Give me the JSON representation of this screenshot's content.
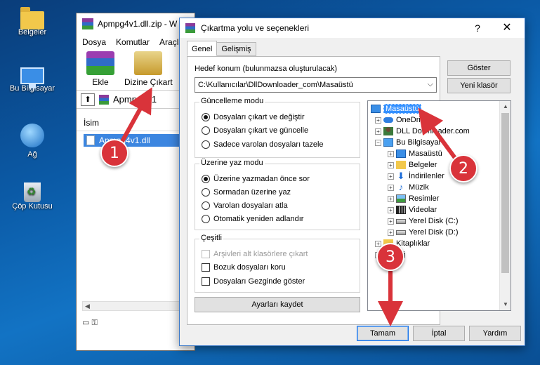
{
  "desktop": {
    "icons": [
      {
        "label": "Belgeler",
        "icon": "user-folder-icon"
      },
      {
        "label": "Bu Bilgisayar",
        "icon": "computer-icon"
      },
      {
        "label": "Ağ",
        "icon": "network-icon"
      },
      {
        "label": "Çöp Kutusu",
        "icon": "recycle-bin-icon"
      }
    ]
  },
  "bg_window": {
    "title": "Apmpg4v1.dll.zip - W",
    "menu": [
      "Dosya",
      "Komutlar",
      "Araçla"
    ],
    "tools": {
      "add": "Ekle",
      "extract": "Dizine Çıkart"
    },
    "path": "Apmpg4v1",
    "column_name": "İsim",
    "file_row": "Apmpg4v1.dll"
  },
  "dialog": {
    "title": "Çıkartma yolu ve seçenekleri",
    "help_symbol": "?",
    "close_symbol": "✕",
    "tabs": [
      "Genel",
      "Gelişmiş"
    ],
    "dest_label": "Hedef konum (bulunmazsa oluşturulacak)",
    "dest_value": "C:\\Kullanıcılar\\DllDownloader_com\\Masaüstü",
    "show_button": "Göster",
    "new_folder_button": "Yeni klasör",
    "update_group": {
      "title": "Güncelleme modu",
      "options": [
        "Dosyaları çıkart ve değiştir",
        "Dosyaları çıkart ve güncelle",
        "Sadece varolan dosyaları tazele"
      ],
      "selected": 0
    },
    "overwrite_group": {
      "title": "Üzerine yaz modu",
      "options": [
        "Üzerine yazmadan önce sor",
        "Sormadan üzerine yaz",
        "Varolan dosyaları atla",
        "Otomatik yeniden adlandır"
      ],
      "selected": 0
    },
    "misc_group": {
      "title": "Çeşitli",
      "options": [
        "Arşivleri alt klasörlere çıkart",
        "Bozuk dosyaları koru",
        "Dosyaları Gezginde göster"
      ]
    },
    "save_settings_button": "Ayarları kaydet",
    "tree": [
      {
        "label": "Masaüstü",
        "icon": "desktop-icon"
      },
      {
        "label": "OneDrive",
        "icon": "cloud-icon"
      },
      {
        "label": "DLL Downloader.com",
        "icon": "user-icon"
      },
      {
        "label": "Bu Bilgisayar",
        "icon": "computer-icon"
      },
      {
        "label": "Masaüstü",
        "icon": "desktop-icon"
      },
      {
        "label": "Belgeler",
        "icon": "folder-icon"
      },
      {
        "label": "İndirilenler",
        "icon": "download-icon"
      },
      {
        "label": "Müzik",
        "icon": "music-icon"
      },
      {
        "label": "Resimler",
        "icon": "pictures-icon"
      },
      {
        "label": "Videolar",
        "icon": "video-icon"
      },
      {
        "label": "Yerel Disk (C:)",
        "icon": "disk-icon"
      },
      {
        "label": "Yerel Disk (D:)",
        "icon": "disk-icon"
      },
      {
        "label": "Kitaplıklar",
        "icon": "folder-icon"
      },
      {
        "label": "Ağ",
        "icon": "network-icon"
      }
    ],
    "ok_button": "Tamam",
    "cancel_button": "İptal",
    "help_button": "Yardım"
  },
  "annotations": [
    "1",
    "2",
    "3"
  ],
  "colors": {
    "annotation": "#d9333a",
    "selection": "#3390ff",
    "dialog_border": "#3a78c8"
  }
}
